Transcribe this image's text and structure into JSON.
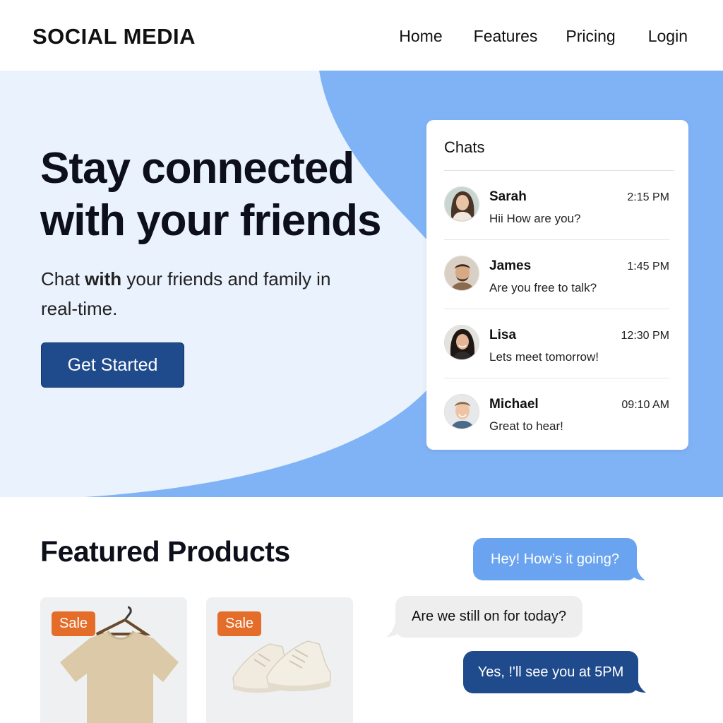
{
  "header": {
    "brand": "SOCIAL MEDIA",
    "nav": [
      "Home",
      "Features",
      "Pricing",
      "Login"
    ]
  },
  "hero": {
    "title_line1": "Stay connected",
    "title_line2": "with your friends",
    "subtitle_part1": "Chat ",
    "subtitle_bold": "with",
    "subtitle_part2": " your friends and family in real-time.",
    "cta_label": "Get Started"
  },
  "chats": {
    "title": "Chats",
    "items": [
      {
        "name": "Sarah",
        "time": "2:15 PM",
        "message": "Hii How are you?"
      },
      {
        "name": "James",
        "time": "1:45 PM",
        "message": "Are you free to talk?"
      },
      {
        "name": "Lisa",
        "time": "12:30 PM",
        "message": "Lets meet tomorrow!"
      },
      {
        "name": "Michael",
        "time": "09:10 AM",
        "message": "Great to hear!"
      }
    ]
  },
  "featured": {
    "title": "Featured Products",
    "products": [
      {
        "badge": "Sale",
        "image": "tshirt-image"
      },
      {
        "badge": "Sale",
        "image": "sneakers-image"
      }
    ]
  },
  "bubbles": {
    "b1": "Hey! How’s it going?",
    "b2": "Are we still on for today?",
    "b3": "Yes, !'ll see you at 5PM"
  },
  "colors": {
    "hero_light": "#eaf2fd",
    "hero_blue": "#80b3f6",
    "primary": "#1f4a8c",
    "sale": "#e56d2a",
    "bubble_light_blue": "#6aa4f0",
    "bubble_gray": "#eeeeee"
  }
}
